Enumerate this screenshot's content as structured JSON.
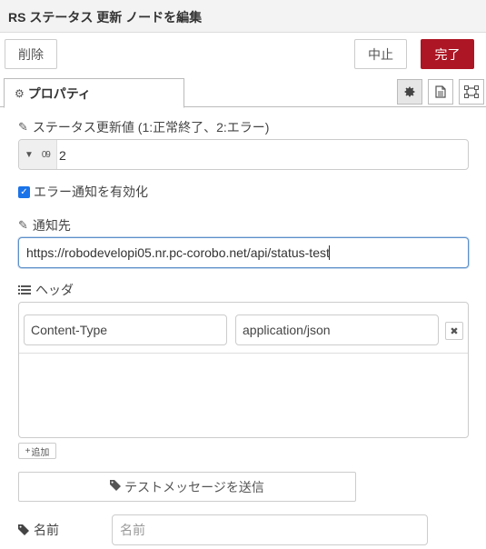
{
  "window": {
    "title": "RS ステータス 更新 ノードを編集"
  },
  "toolbar": {
    "delete_label": "削除",
    "cancel_label": "中止",
    "done_label": "完了"
  },
  "tabs": [
    {
      "label": "プロパティ",
      "icon": "gear-icon"
    }
  ],
  "tab_icons": [
    "gear-icon",
    "document-icon",
    "frame-icon"
  ],
  "form": {
    "status_value": {
      "label": "ステータス更新値 (1:正常終了、2:エラー)",
      "type_badge": "0 9",
      "value": "2"
    },
    "error_notify": {
      "label": "エラー通知を有効化",
      "checked": true
    },
    "notify_url": {
      "label": "通知先",
      "value": "https://robodevelopi05.nr.pc-corobo.net/api/status-test"
    },
    "headers": {
      "label": "ヘッダ",
      "rows": [
        {
          "key": "Content-Type",
          "value": "application/json"
        }
      ],
      "add_label": "追加"
    },
    "test_button_label": "テストメッセージを送信",
    "name": {
      "label": "名前",
      "placeholder": "名前",
      "value": ""
    }
  },
  "colors": {
    "done": "#ad1625",
    "checkbox": "#1a73e8",
    "focus_border": "#5b8fc9"
  }
}
